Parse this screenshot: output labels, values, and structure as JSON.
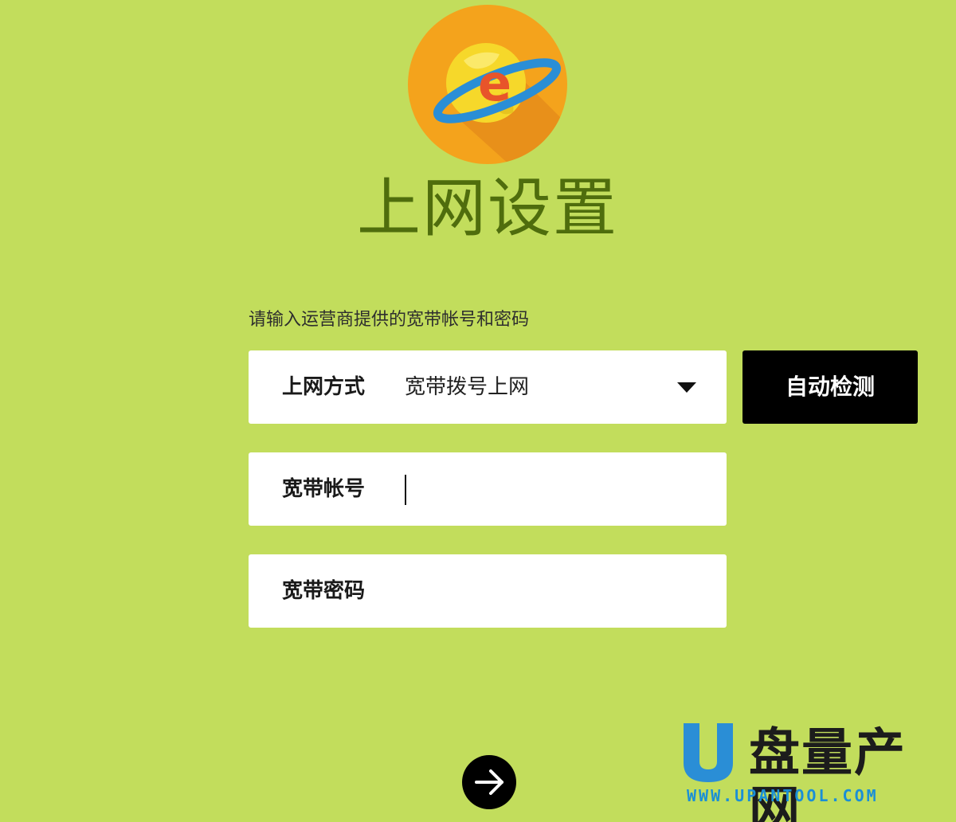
{
  "page": {
    "title": "上网设置",
    "instruction": "请输入运营商提供的宽带帐号和密码"
  },
  "logo": {
    "icon": "ie-globe-icon",
    "letter": "e"
  },
  "form": {
    "connection_type": {
      "label": "上网方式",
      "selected_value": "宽带拨号上网"
    },
    "account": {
      "label": "宽带帐号",
      "value": ""
    },
    "password": {
      "label": "宽带密码",
      "value": ""
    }
  },
  "buttons": {
    "auto_detect_label": "自动检测",
    "next_icon": "arrow-right-icon"
  },
  "watermark": {
    "brand_text": "盘量产网",
    "url": "WWW.UPANTOOL.COM"
  },
  "colors": {
    "background": "#c2dd5c",
    "title": "#4f6d0d",
    "button_bg": "#000000",
    "watermark_blue": "#1a8fd6"
  }
}
